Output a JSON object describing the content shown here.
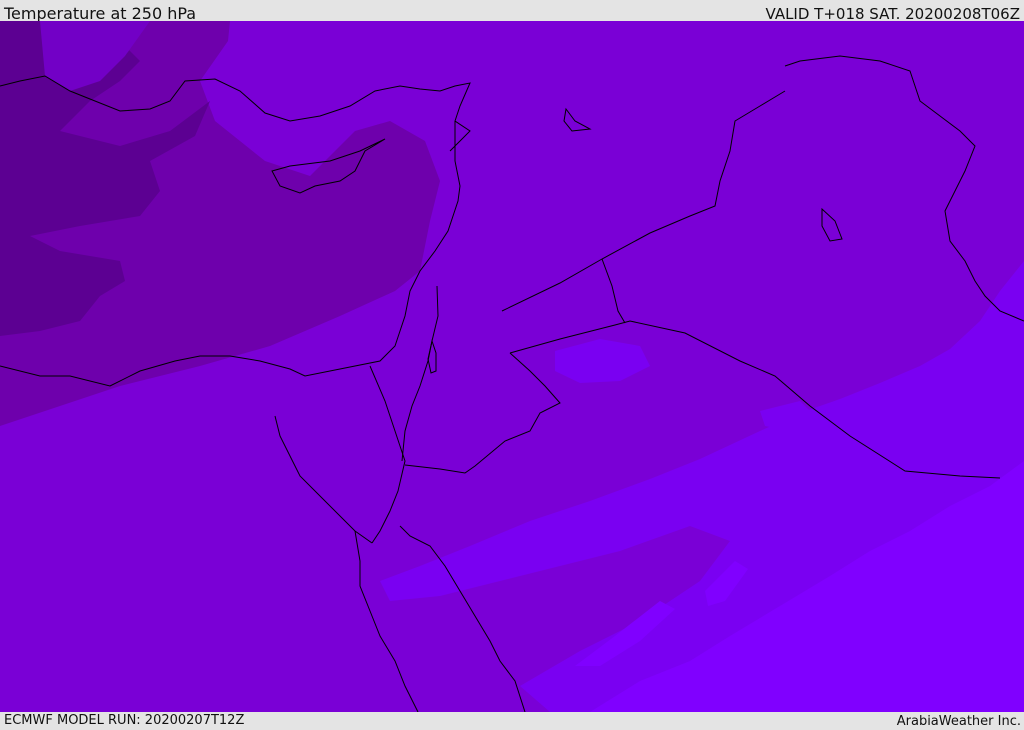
{
  "header": {
    "title": "Temperature at 250 hPa",
    "valid_time": "VALID T+018 SAT. 20200208T06Z"
  },
  "footer": {
    "model_run": "ECMWF MODEL RUN: 20200207T12Z",
    "credit": "ArabiaWeather Inc."
  },
  "map": {
    "variable": "temperature",
    "level": "250 hPa",
    "region": "Eastern Mediterranean and Middle East",
    "colors": {
      "coldest": "#5c0092",
      "colder": "#6e00ac",
      "base": "#7a00d6",
      "warmer": "#7a00f2",
      "warmest": "#8000ff",
      "coast": "#000000"
    }
  }
}
